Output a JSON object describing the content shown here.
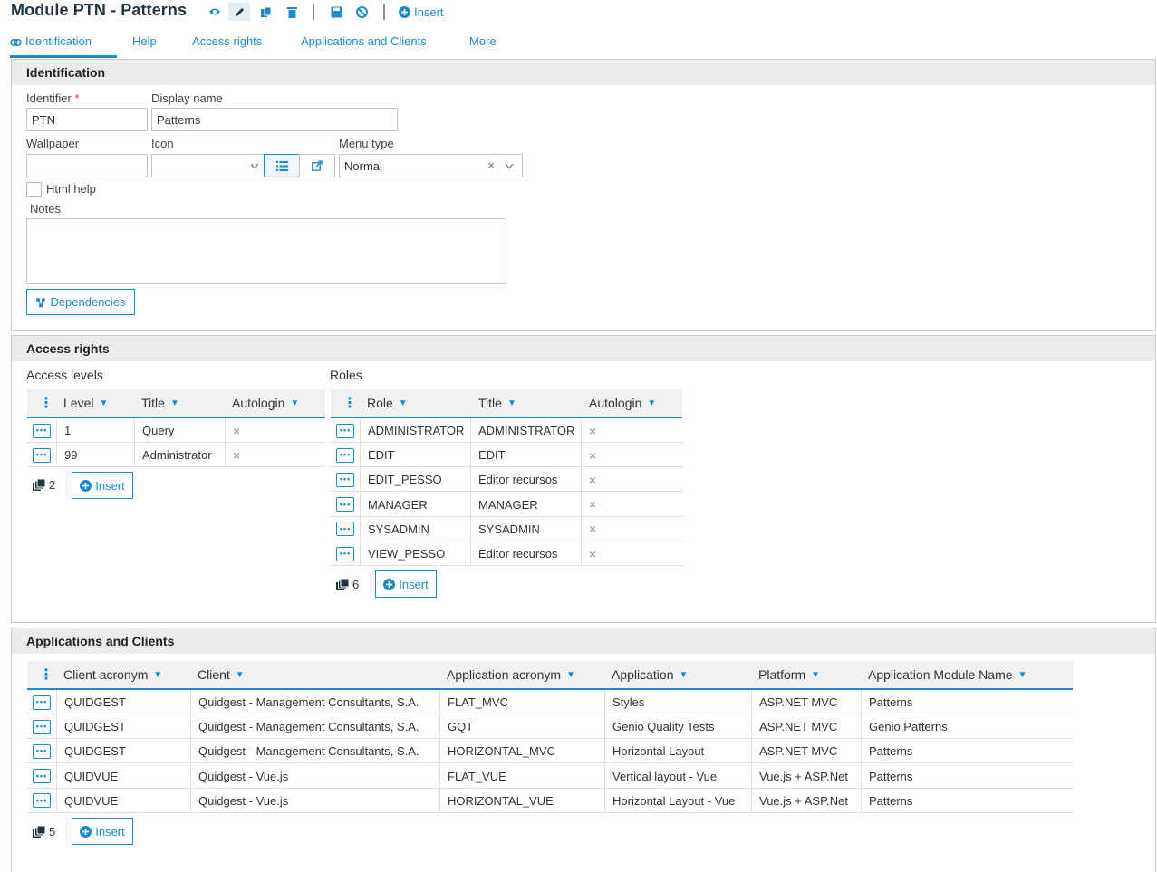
{
  "header": {
    "title": "Module PTN - Patterns",
    "insert_label": "Insert"
  },
  "tabs": [
    {
      "label": "Identification"
    },
    {
      "label": "Help"
    },
    {
      "label": "Access rights"
    },
    {
      "label": "Applications and Clients"
    },
    {
      "label": "More"
    }
  ],
  "identification": {
    "heading": "Identification",
    "identifier_label": "Identifier",
    "required_mark": "*",
    "identifier_value": "PTN",
    "display_name_label": "Display name",
    "display_name_value": "Patterns",
    "wallpaper_label": "Wallpaper",
    "wallpaper_value": "",
    "icon_label": "Icon",
    "menu_type_label": "Menu type",
    "menu_type_value": "Normal",
    "html_help_label": "Html help",
    "notes_label": "Notes",
    "notes_value": "",
    "dependencies_label": "Dependencies"
  },
  "access_rights": {
    "heading": "Access rights",
    "levels": {
      "label": "Access levels",
      "columns": [
        "Level",
        "Title",
        "Autologin"
      ],
      "rows": [
        {
          "level": "1",
          "title": "Query",
          "autologin": "×"
        },
        {
          "level": "99",
          "title": "Administrator",
          "autologin": "×"
        }
      ],
      "count": "2",
      "insert_label": "Insert"
    },
    "roles": {
      "label": "Roles",
      "columns": [
        "Role",
        "Title",
        "Autologin"
      ],
      "rows": [
        {
          "role": "ADMINISTRATOR",
          "title": "ADMINISTRATOR",
          "autologin": "×"
        },
        {
          "role": "EDIT",
          "title": "EDIT",
          "autologin": "×"
        },
        {
          "role": "EDIT_PESSO",
          "title": "Editor recursos",
          "autologin": "×"
        },
        {
          "role": "MANAGER",
          "title": "MANAGER",
          "autologin": "×"
        },
        {
          "role": "SYSADMIN",
          "title": "SYSADMIN",
          "autologin": "×"
        },
        {
          "role": "VIEW_PESSO",
          "title": "Editor recursos",
          "autologin": "×"
        }
      ],
      "count": "6",
      "insert_label": "Insert"
    }
  },
  "applications": {
    "heading": "Applications and Clients",
    "columns": [
      "Client acronym",
      "Client",
      "Application acronym",
      "Application",
      "Platform",
      "Application Module Name"
    ],
    "rows": [
      {
        "client_acronym": "QUIDGEST",
        "client": "Quidgest - Management Consultants, S.A.",
        "app_acronym": "FLAT_MVC",
        "application": "Styles",
        "platform": "ASP.NET MVC",
        "module_name": "Patterns"
      },
      {
        "client_acronym": "QUIDGEST",
        "client": "Quidgest - Management Consultants, S.A.",
        "app_acronym": "GQT",
        "application": "Genio Quality Tests",
        "platform": "ASP.NET MVC",
        "module_name": "Genio Patterns"
      },
      {
        "client_acronym": "QUIDGEST",
        "client": "Quidgest - Management Consultants, S.A.",
        "app_acronym": "HORIZONTAL_MVC",
        "application": "Horizontal Layout",
        "platform": "ASP.NET MVC",
        "module_name": "Patterns"
      },
      {
        "client_acronym": "QUIDVUE",
        "client": "Quidgest - Vue.js",
        "app_acronym": "FLAT_VUE",
        "application": "Vertical layout - Vue",
        "platform": "Vue.js + ASP.Net",
        "module_name": "Patterns"
      },
      {
        "client_acronym": "QUIDVUE",
        "client": "Quidgest - Vue.js",
        "app_acronym": "HORIZONTAL_VUE",
        "application": "Horizontal Layout - Vue",
        "platform": "Vue.js + ASP.Net",
        "module_name": "Patterns"
      }
    ],
    "count": "5",
    "insert_label": "Insert"
  },
  "icons": {
    "toolbar": [
      "eye-icon",
      "pencil-icon",
      "copy-icon",
      "trash-icon",
      "save-icon",
      "cancel-icon",
      "plus-circle-icon"
    ],
    "row_action": "ellipsis-icon",
    "column_menu": "kebab-icon",
    "sort": "chevron-down-icon",
    "records": "stack-icon"
  },
  "colors": {
    "accent": "#1a8bd1",
    "section_header_bg": "#ececec",
    "grid_header_bg": "#f0f1f2"
  }
}
